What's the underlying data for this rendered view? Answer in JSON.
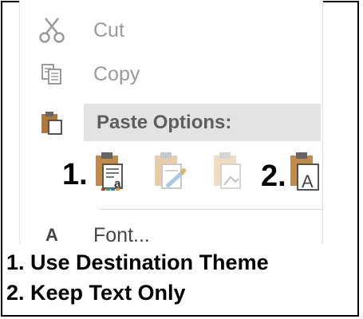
{
  "context_menu": {
    "items": [
      {
        "label": "Cut",
        "icon": "scissors-icon",
        "enabled": false
      },
      {
        "label": "Copy",
        "icon": "copy-icon",
        "enabled": false
      }
    ],
    "paste_options": {
      "heading": "Paste Options:",
      "icon": "clipboard-icon",
      "buttons": [
        {
          "number": "1.",
          "icon": "use-destination-theme-icon"
        },
        {
          "icon": "keep-source-formatting-icon"
        },
        {
          "icon": "picture-paste-icon"
        },
        {
          "number": "2.",
          "icon": "keep-text-only-icon"
        }
      ]
    },
    "font_item": {
      "label": "Font...",
      "icon_glyph": "A",
      "enabled": true
    }
  },
  "annotations": [
    "1. Use Destination Theme",
    "2. Keep Text Only"
  ],
  "colors": {
    "menu_background": "#ffffff",
    "heading_background": "#e3e3e3",
    "disabled_text": "#9a9a9a",
    "enabled_text": "#444444",
    "clipboard_brown": "#b0793b",
    "frame": "#000000"
  }
}
